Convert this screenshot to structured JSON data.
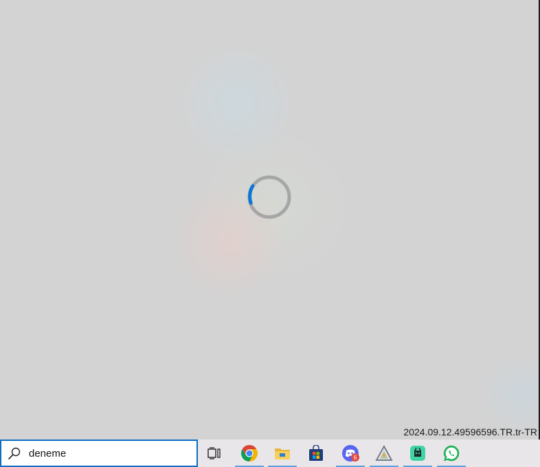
{
  "search_results": {
    "loading": true,
    "version_text": "2024.09.12.49596596.TR.tr-TR"
  },
  "taskbar": {
    "search": {
      "value": "deneme"
    },
    "buttons": [
      {
        "icon": "task-view-icon",
        "running": false
      },
      {
        "icon": "chrome-icon",
        "running": true
      },
      {
        "icon": "file-explorer-icon",
        "running": true
      },
      {
        "icon": "microsoft-store-icon",
        "running": false
      },
      {
        "icon": "discord-icon",
        "running": true,
        "badge": "6"
      },
      {
        "icon": "app-icon",
        "running": true
      },
      {
        "icon": "app-icon",
        "running": true
      },
      {
        "icon": "whatsapp-icon",
        "running": true
      }
    ]
  },
  "colors": {
    "accent": "#0b6cc4",
    "taskbar": "#e8e6e8",
    "spinner_track": "#a6a6a6",
    "spinner_arc": "#0a76d6"
  }
}
